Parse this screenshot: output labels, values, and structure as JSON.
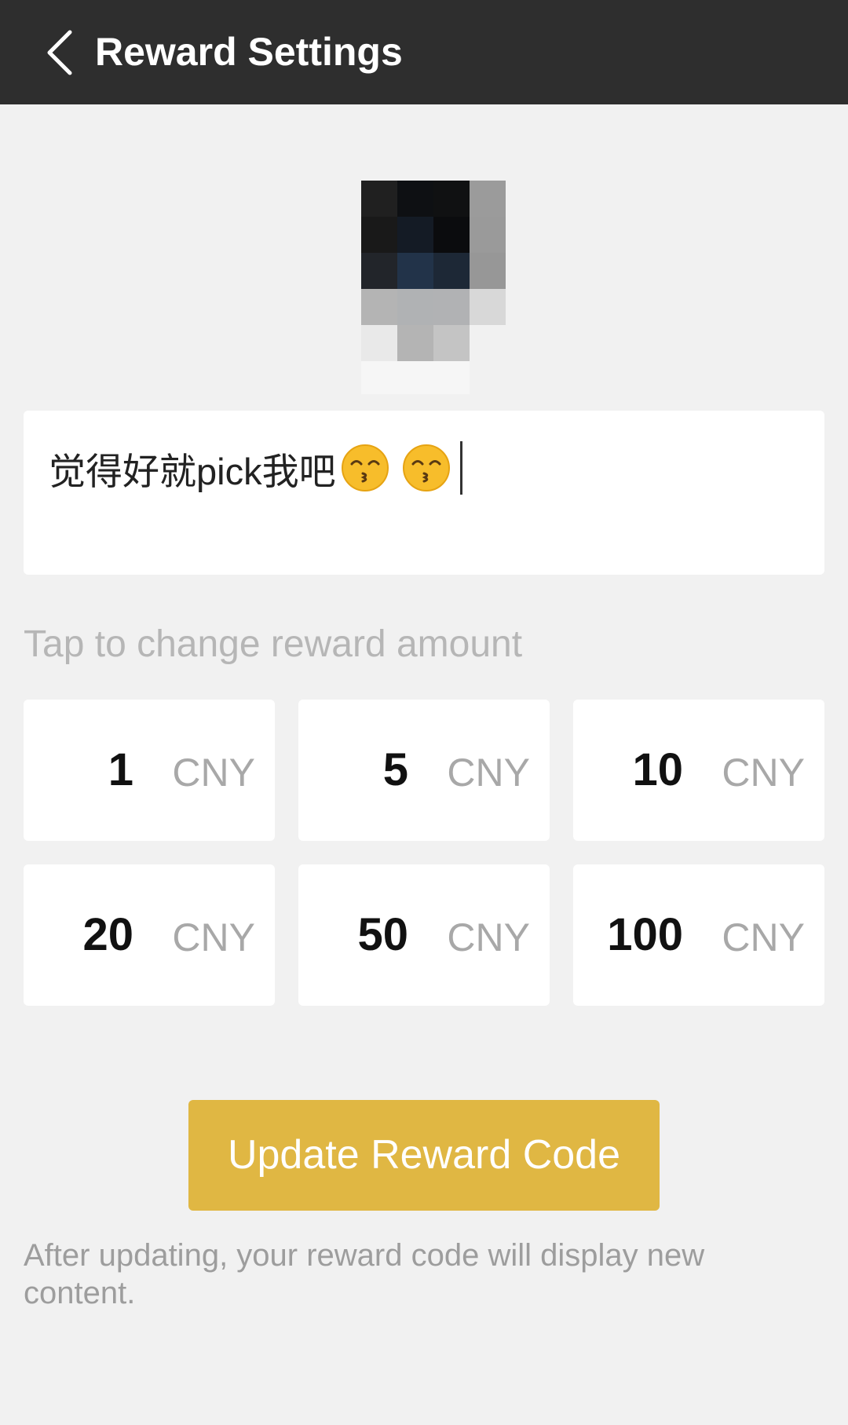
{
  "header": {
    "title": "Reward Settings",
    "back_icon": "chevron-left-icon"
  },
  "avatar": {
    "description_icon": "avatar-image"
  },
  "message": {
    "text": "觉得好就pick我吧",
    "emojis": [
      "kissing-face-with-smiling-eyes",
      "kissing-face-with-smiling-eyes"
    ]
  },
  "amounts": {
    "label": "Tap to change reward amount",
    "items": [
      {
        "value": "1",
        "unit": "CNY"
      },
      {
        "value": "5",
        "unit": "CNY"
      },
      {
        "value": "10",
        "unit": "CNY"
      },
      {
        "value": "20",
        "unit": "CNY"
      },
      {
        "value": "50",
        "unit": "CNY"
      },
      {
        "value": "100",
        "unit": "CNY"
      }
    ]
  },
  "actions": {
    "update_label": "Update Reward Code"
  },
  "footer": {
    "note": "After updating, your reward code will display new content."
  },
  "colors": {
    "app_bar": "#2e2e2e",
    "background": "#f1f1f1",
    "accent_button": "#e0b743",
    "muted_text": "#a8a8a8"
  }
}
